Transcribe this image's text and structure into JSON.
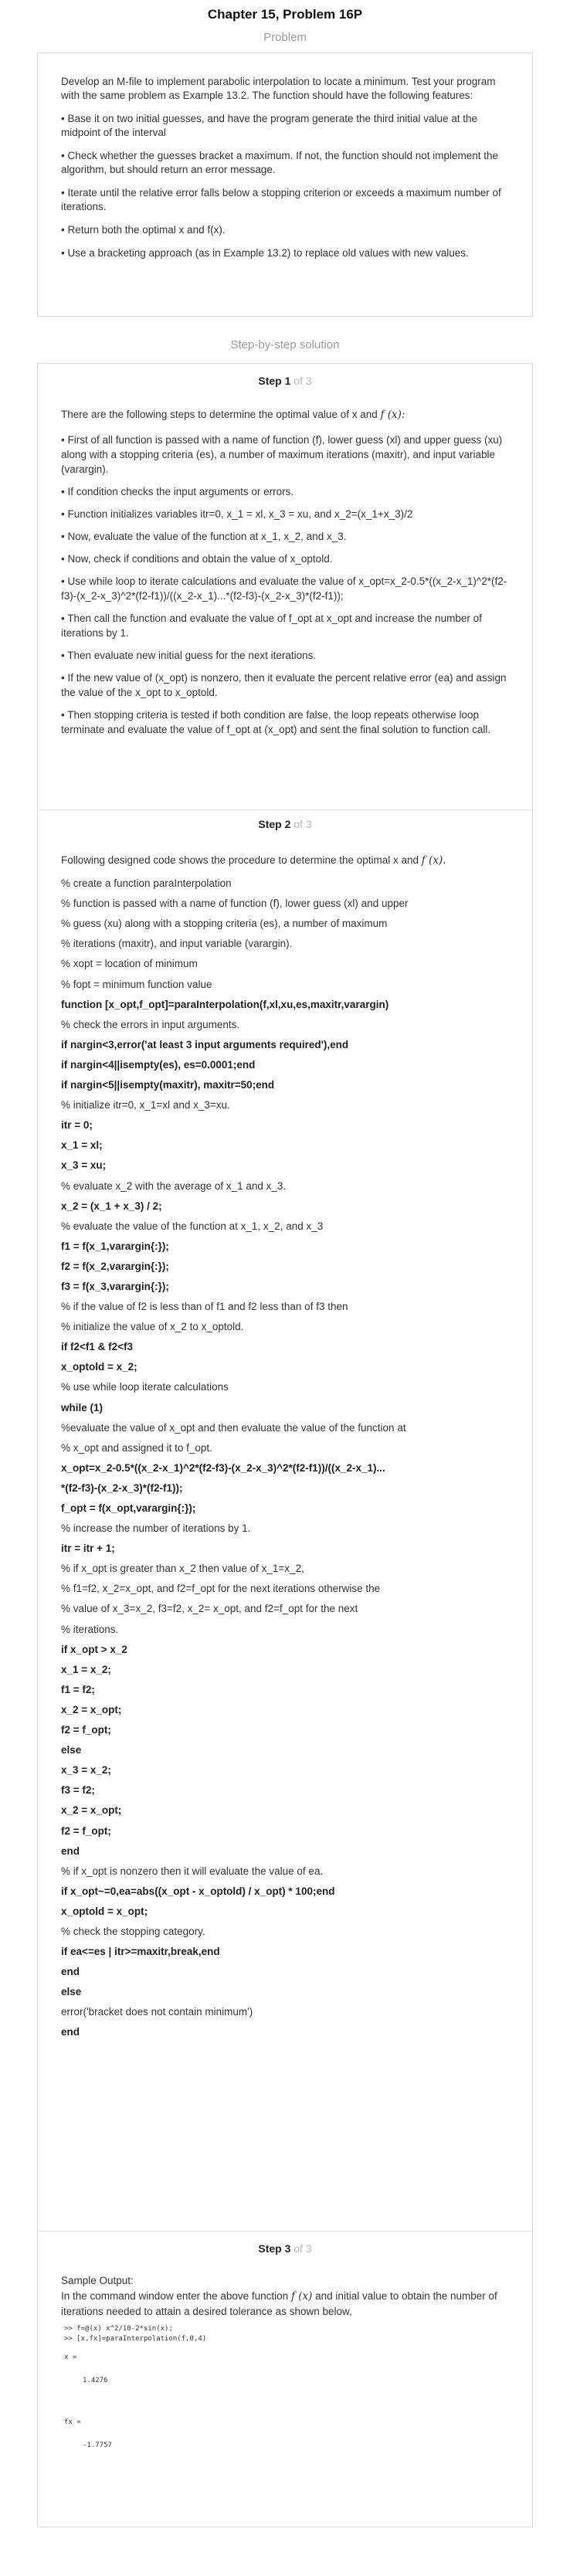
{
  "header": {
    "title": "Chapter 15, Problem 16P"
  },
  "problem": {
    "label": "Problem",
    "paragraphs": [
      "Develop an M-file to implement parabolic interpolation to locate a minimum. Test your program with the same problem as Example 13.2. The function should have the following features:",
      "• Base it on two initial guesses, and have the program generate the third initial value at the midpoint of the interval",
      "• Check whether the guesses bracket a maximum. If not, the function should not implement the algorithm, but should return an error message.",
      "• Iterate until the relative error falls below a stopping criterion or exceeds a maximum number of iterations.",
      "• Return both the optimal x and f(x).",
      "• Use a bracketing approach (as in Example 13.2) to replace old values with new values."
    ]
  },
  "solution": {
    "label": "Step-by-step solution",
    "step_word": "Step",
    "of_total": "of 3",
    "step1": {
      "number": "1",
      "intro_text": "There are the following steps to determine the optimal value of x and",
      "intro_math": "f (x):",
      "bullets": [
        "• First of all function is passed with a name of function (f), lower guess (xl) and upper guess (xu) along with a stopping criteria (es), a number of maximum iterations (maxitr), and input variable (varargin).",
        "• If condition checks the input arguments or errors.",
        "• Function initializes variables itr=0, x_1 = xl, x_3 = xu, and x_2=(x_1+x_3)/2",
        "• Now, evaluate the value of the function at x_1, x_2, and x_3.",
        "• Now, check if conditions and obtain the value of x_optold.",
        "• Use while loop to iterate calculations and evaluate the value of x_opt=x_2-0.5*((x_2-x_1)^2*(f2-f3)-(x_2-x_3)^2*(f2-f1))/((x_2-x_1)...*(f2-f3)-(x_2-x_3)*(f2-f1));",
        "• Then call the function and evaluate the value of f_opt at x_opt and increase the number of iterations by 1.",
        "• Then evaluate new initial guess for the next iterations.",
        "• If the new value of (x_opt) is nonzero, then it evaluate the percent relative error (ea) and assign the value of the x_opt to x_optold.",
        "• Then stopping criteria is tested if both condition are false, the loop repeats otherwise loop terminate and evaluate the value of f_opt at (x_opt) and sent the final solution to function call."
      ]
    },
    "step2": {
      "number": "2",
      "intro_text": "Following designed code shows the procedure to determine the optimal x and",
      "intro_math": "f (x).",
      "code_lines": [
        "% create a function paraInterpolation",
        "% function is passed with a name of function (f), lower guess (xl) and upper",
        "% guess (xu) along with a stopping criteria (es), a number of maximum",
        "% iterations (maxitr), and input variable (varargin).",
        "% xopt = location of minimum",
        "% fopt = minimum function value",
        "function [x_opt,f_opt]=paraInterpolation(f,xl,xu,es,maxitr,varargin)",
        "% check the errors in input arguments.",
        "if nargin<3,error('at least 3 input arguments required'),end",
        "if nargin<4||isempty(es), es=0.0001;end",
        "if nargin<5||isempty(maxitr), maxitr=50;end",
        "% initialize itr=0, x_1=xl and x_3=xu.",
        "itr = 0;",
        "x_1 = xl;",
        "x_3 = xu;",
        "% evaluate x_2 with the average of x_1 and x_3.",
        "x_2 = (x_1 + x_3) / 2;",
        "% evaluate the value of the function at x_1, x_2, and x_3",
        "f1 = f(x_1,varargin{:});",
        "f2 = f(x_2,varargin{:});",
        "f3 = f(x_3,varargin{:});",
        "% if the value of f2 is less than of f1 and f2 less than of f3 then",
        "% initialize the value of x_2 to x_optold.",
        "if f2<f1 & f2<f3",
        "x_optold = x_2;",
        "% use while loop iterate calculations",
        "while (1)",
        "%evaluate the value of x_opt and then evaluate the value of the function at",
        "% x_opt and assigned it to f_opt.",
        "x_opt=x_2-0.5*((x_2-x_1)^2*(f2-f3)-(x_2-x_3)^2*(f2-f1))/((x_2-x_1)...",
        "*(f2-f3)-(x_2-x_3)*(f2-f1));",
        "f_opt = f(x_opt,varargin{:});",
        "% increase the number of iterations by 1.",
        "itr = itr + 1;",
        "% if x_opt is greater than x_2 then value of x_1=x_2,",
        "% f1=f2, x_2=x_opt, and f2=f_opt for the next iterations otherwise the",
        "% value of x_3=x_2, f3=f2, x_2= x_opt, and f2=f_opt for the next",
        "% iterations.",
        "if x_opt > x_2",
        "x_1 = x_2;",
        "f1 = f2;",
        "x_2 = x_opt;",
        "f2 = f_opt;",
        "else",
        "x_3 = x_2;",
        "f3 = f2;",
        "x_2 = x_opt;",
        "f2 = f_opt;",
        "end",
        "% if x_opt is nonzero then it will evaluate the value of ea.",
        "if x_opt~=0,ea=abs((x_opt - x_optold) / x_opt) * 100;end",
        "x_optold = x_opt;",
        "% check the stopping category.",
        "if ea<=es | itr>=maxitr,break,end",
        "end",
        "else",
        "error('bracket does not contain minimum')",
        "end"
      ],
      "bold_lines": [
        6,
        8,
        9,
        10,
        12,
        13,
        14,
        16,
        18,
        19,
        20,
        23,
        24,
        26,
        29,
        30,
        31,
        33,
        38,
        39,
        40,
        41,
        42,
        43,
        44,
        45,
        46,
        47,
        48,
        50,
        51,
        53,
        54,
        55,
        57
      ]
    },
    "step3": {
      "number": "3",
      "sample_label": "Sample Output:",
      "desc_before": "In the command window enter the above function",
      "desc_math": "f (x)",
      "desc_after": "and initial value to obtain the number of iterations needed to attain a desired tolerance as shown below,",
      "command_lines": [
        ">> f=@(x) x^2/10-2*sin(x);",
        ">> [x,fx]=paraInterpolation(f,0,4)"
      ],
      "output": [
        {
          "name": "x =",
          "value": "1.4276"
        },
        {
          "name": "fx =",
          "value": "-1.7757"
        }
      ]
    }
  }
}
